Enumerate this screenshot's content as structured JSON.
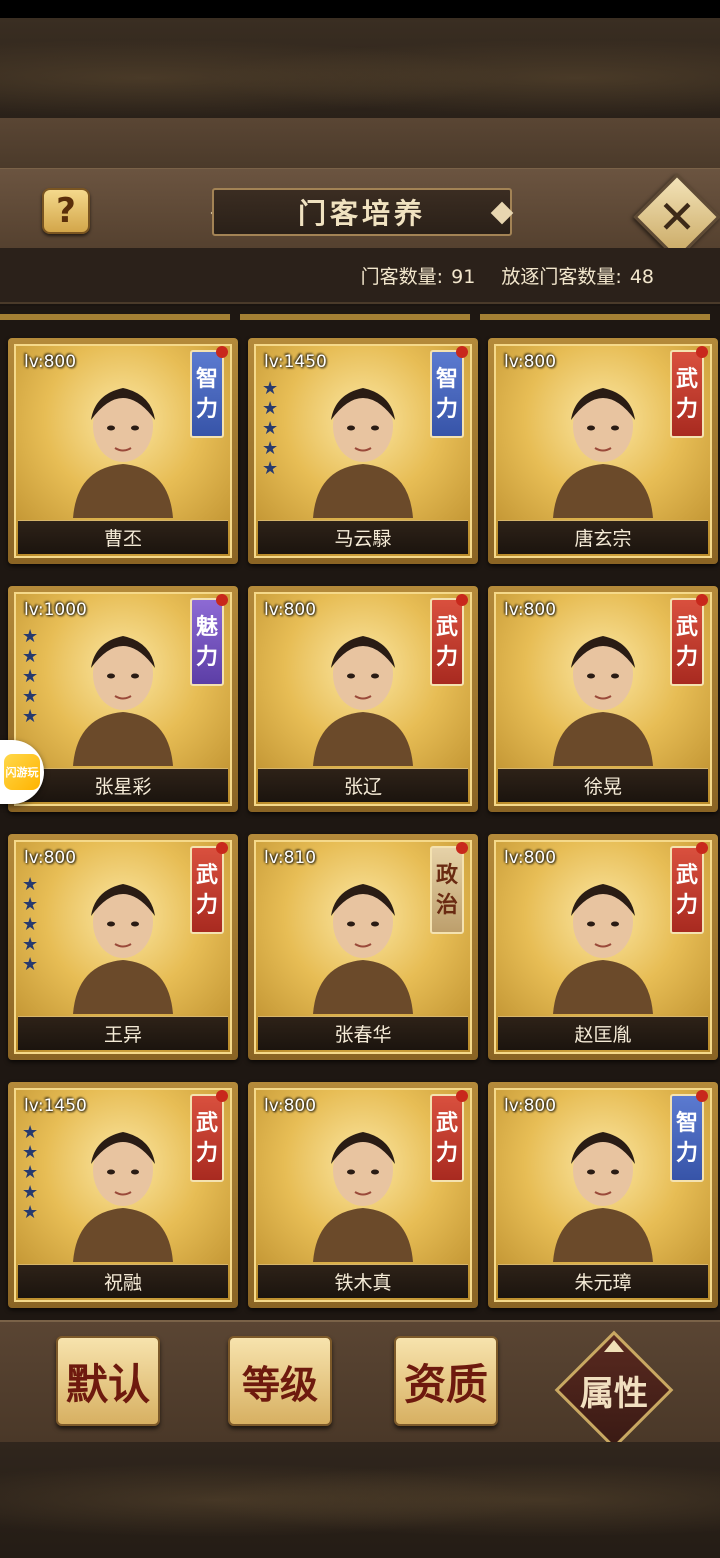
{
  "header": {
    "title": "门客培养",
    "help_icon": "question-icon",
    "close_icon": "close-icon"
  },
  "stats": {
    "retainer_count_label": "门客数量:",
    "retainer_count": "91",
    "exiled_count_label": "放逐门客数量:",
    "exiled_count": "48"
  },
  "colors": {
    "zhi_tag": "#3754a8",
    "wu_tag": "#a82a20",
    "mei_tag": "#5c3ea6",
    "zheng_tag": "#bd9f6c"
  },
  "cards": [
    {
      "level": "lv:800",
      "tag_top": "智",
      "tag_bottom": "力",
      "tag_color": "blue",
      "name": "曹丕",
      "stars": 0
    },
    {
      "level": "lv:1450",
      "tag_top": "智",
      "tag_bottom": "力",
      "tag_color": "blue",
      "name": "马云騄",
      "stars": 5
    },
    {
      "level": "lv:800",
      "tag_top": "武",
      "tag_bottom": "力",
      "tag_color": "red",
      "name": "唐玄宗",
      "stars": 0
    },
    {
      "level": "lv:1000",
      "tag_top": "魅",
      "tag_bottom": "力",
      "tag_color": "purple",
      "name": "张星彩",
      "stars": 5
    },
    {
      "level": "lv:800",
      "tag_top": "武",
      "tag_bottom": "力",
      "tag_color": "red",
      "name": "张辽",
      "stars": 0
    },
    {
      "level": "lv:800",
      "tag_top": "武",
      "tag_bottom": "力",
      "tag_color": "red",
      "name": "徐晃",
      "stars": 0
    },
    {
      "level": "lv:800",
      "tag_top": "武",
      "tag_bottom": "力",
      "tag_color": "red",
      "name": "王异",
      "stars": 5
    },
    {
      "level": "lv:810",
      "tag_top": "政",
      "tag_bottom": "治",
      "tag_color": "cream",
      "name": "张春华",
      "stars": 0
    },
    {
      "level": "lv:800",
      "tag_top": "武",
      "tag_bottom": "力",
      "tag_color": "red",
      "name": "赵匡胤",
      "stars": 0
    },
    {
      "level": "lv:1450",
      "tag_top": "武",
      "tag_bottom": "力",
      "tag_color": "red",
      "name": "祝融",
      "stars": 5
    },
    {
      "level": "lv:800",
      "tag_top": "武",
      "tag_bottom": "力",
      "tag_color": "red",
      "name": "铁木真",
      "stars": 0
    },
    {
      "level": "lv:800",
      "tag_top": "智",
      "tag_bottom": "力",
      "tag_color": "blue",
      "name": "朱元璋",
      "stars": 0
    }
  ],
  "sort_bar": {
    "default_label": "默认",
    "level_label": "等级",
    "aptitude_label": "资质",
    "attribute_label": "属性"
  },
  "float_badge": {
    "label": "闪游玩"
  }
}
